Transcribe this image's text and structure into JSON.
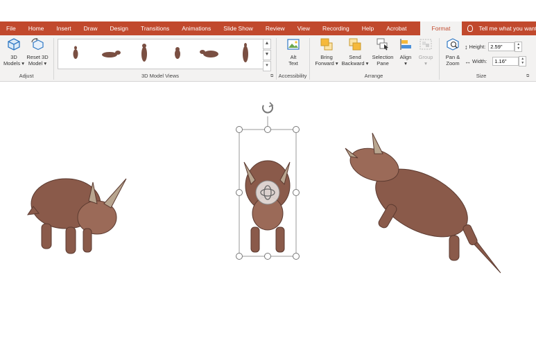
{
  "tabs": [
    "File",
    "Home",
    "Insert",
    "Draw",
    "Design",
    "Transitions",
    "Animations",
    "Slide Show",
    "Review",
    "View",
    "Recording",
    "Help",
    "Acrobat"
  ],
  "active_tab": "Format",
  "tell_me": "Tell me what you want to",
  "groups": {
    "adjust": {
      "label": "Adjust",
      "models_line1": "3D",
      "models_line2": "Models",
      "reset_line1": "Reset 3D",
      "reset_line2": "Model"
    },
    "views": {
      "label": "3D Model Views"
    },
    "accessibility": {
      "label": "Accessibility",
      "alt_line1": "Alt",
      "alt_line2": "Text"
    },
    "arrange": {
      "label": "Arrange",
      "bring_line1": "Bring",
      "bring_line2": "Forward",
      "send_line1": "Send",
      "send_line2": "Backward",
      "selection_line1": "Selection",
      "selection_line2": "Pane",
      "align": "Align",
      "group": "Group"
    },
    "size": {
      "label": "Size",
      "pan_line1": "Pan &",
      "pan_line2": "Zoom",
      "height_label": "Height:",
      "height_value": "2.59\"",
      "width_label": "Width:",
      "width_value": "1.16\""
    }
  },
  "colors": {
    "ribbon_tab_bg": "#c1492d",
    "ribbon_bg": "#f3f2f1",
    "dino_body": "#8a5a4a"
  },
  "icons": [
    "3d-models-icon",
    "reset-model-icon",
    "alt-text-icon",
    "bring-forward-icon",
    "send-backward-icon",
    "selection-pane-icon",
    "align-icon",
    "group-icon",
    "pan-zoom-icon",
    "height-icon",
    "width-icon",
    "rotate-handle-icon",
    "3d-rotate-control-icon",
    "lightbulb-icon"
  ]
}
